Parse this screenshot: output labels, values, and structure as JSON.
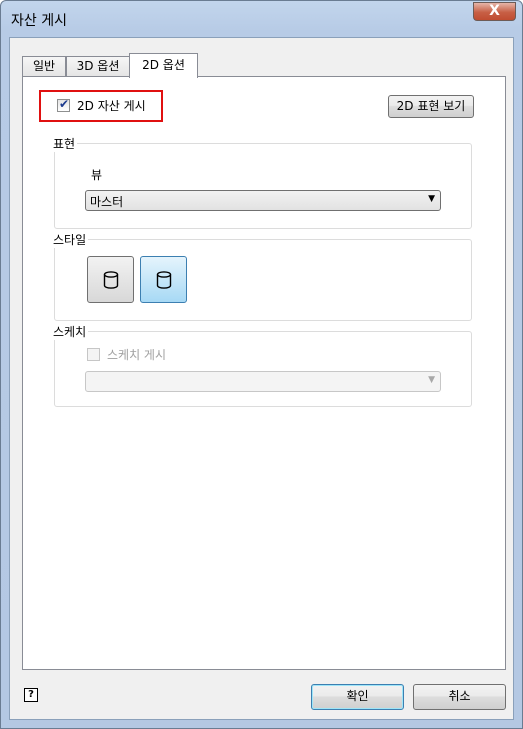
{
  "window": {
    "title": "자산 게시",
    "close_label": "X"
  },
  "tabs": [
    {
      "label": "일반",
      "active": false
    },
    {
      "label": "3D 옵션",
      "active": false
    },
    {
      "label": "2D 옵션",
      "active": true
    }
  ],
  "publish_2d": {
    "label": "2D 자산 게시",
    "checked": true
  },
  "preview_button": {
    "label": "2D 표현 보기"
  },
  "representation": {
    "group_label": "표현",
    "view_label": "뷰",
    "view_value": "마스터"
  },
  "style": {
    "group_label": "스타일",
    "buttons": [
      {
        "icon": "cylinder-icon",
        "selected": false
      },
      {
        "icon": "cylinder-icon",
        "selected": true
      }
    ]
  },
  "sketch": {
    "group_label": "스케치",
    "publish_label": "스케치 게시",
    "checked": false,
    "enabled": false,
    "dropdown_value": ""
  },
  "footer": {
    "help_icon": "help-icon",
    "help_glyph": "?",
    "ok_label": "확인",
    "cancel_label": "취소"
  }
}
